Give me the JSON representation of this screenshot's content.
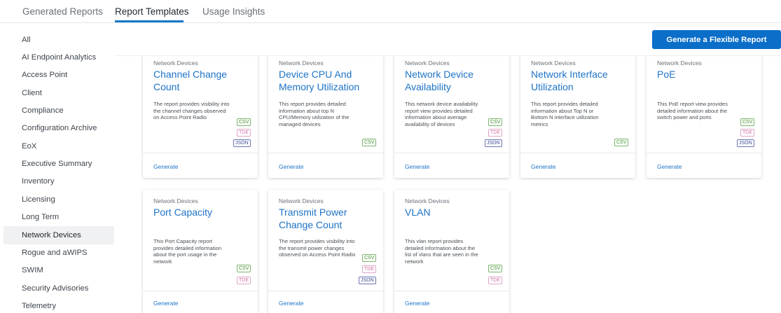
{
  "tabs": [
    {
      "label": "Generated Reports"
    },
    {
      "label": "Report Templates"
    },
    {
      "label": "Usage Insights"
    }
  ],
  "sidebar": {
    "items": [
      {
        "label": "All"
      },
      {
        "label": "AI Endpoint Analytics"
      },
      {
        "label": "Access Point"
      },
      {
        "label": "Client"
      },
      {
        "label": "Compliance"
      },
      {
        "label": "Configuration Archive"
      },
      {
        "label": "EoX"
      },
      {
        "label": "Executive Summary"
      },
      {
        "label": "Inventory"
      },
      {
        "label": "Licensing"
      },
      {
        "label": "Long Term"
      },
      {
        "label": "Network Devices"
      },
      {
        "label": "Rogue and aWIPS"
      },
      {
        "label": "SWIM"
      },
      {
        "label": "Security Advisories"
      },
      {
        "label": "Telemetry"
      }
    ],
    "active": "Network Devices"
  },
  "actions": {
    "flexible_report_label": "Generate a Flexible Report"
  },
  "cards": [
    {
      "category": "Network Devices",
      "title": "Channel Change Count",
      "description": "The report provides visibility into the channel changes observed on Access Point Radio",
      "formats": [
        "CSV",
        "TDE",
        "JSON"
      ],
      "action": "Generate"
    },
    {
      "category": "Network Devices",
      "title": "Device CPU And Memory Utilization",
      "description": "This report provides detailed information about top N CPU/Memory utilization of the managed devices",
      "formats": [
        "CSV"
      ],
      "action": "Generate"
    },
    {
      "category": "Network Devices",
      "title": "Network Device Availability",
      "description": "This network device availability report view provides detailed information about average availability of devices",
      "formats": [
        "CSV",
        "TDE",
        "JSON"
      ],
      "action": "Generate"
    },
    {
      "category": "Network Devices",
      "title": "Network Interface Utilization",
      "description": "This report provides detailed information about Top N or Bottom N interface utilization metrics",
      "formats": [
        "CSV"
      ],
      "action": "Generate"
    },
    {
      "category": "Network Devices",
      "title": "PoE",
      "description": "This PoE report view provides detailed information about the switch power and ports",
      "formats": [
        "CSV",
        "TDE",
        "JSON"
      ],
      "action": "Generate"
    },
    {
      "category": "Network Devices",
      "title": "Port Capacity",
      "description": "This Port Capacity report provides detailed information about the port usage in the network",
      "formats": [
        "CSV",
        "TDE"
      ],
      "action": "Generate"
    },
    {
      "category": "Network Devices",
      "title": "Transmit Power Change Count",
      "description": "The report provides visibility into the transmit power changes observed on Access Point Radio",
      "formats": [
        "CSV",
        "TDE",
        "JSON"
      ],
      "action": "Generate"
    },
    {
      "category": "Network Devices",
      "title": "VLAN",
      "description": "This vlan report provides detailed information about the list of vlans that are seen in the network",
      "formats": [
        "CSV",
        "TDE"
      ],
      "action": "Generate"
    }
  ]
}
